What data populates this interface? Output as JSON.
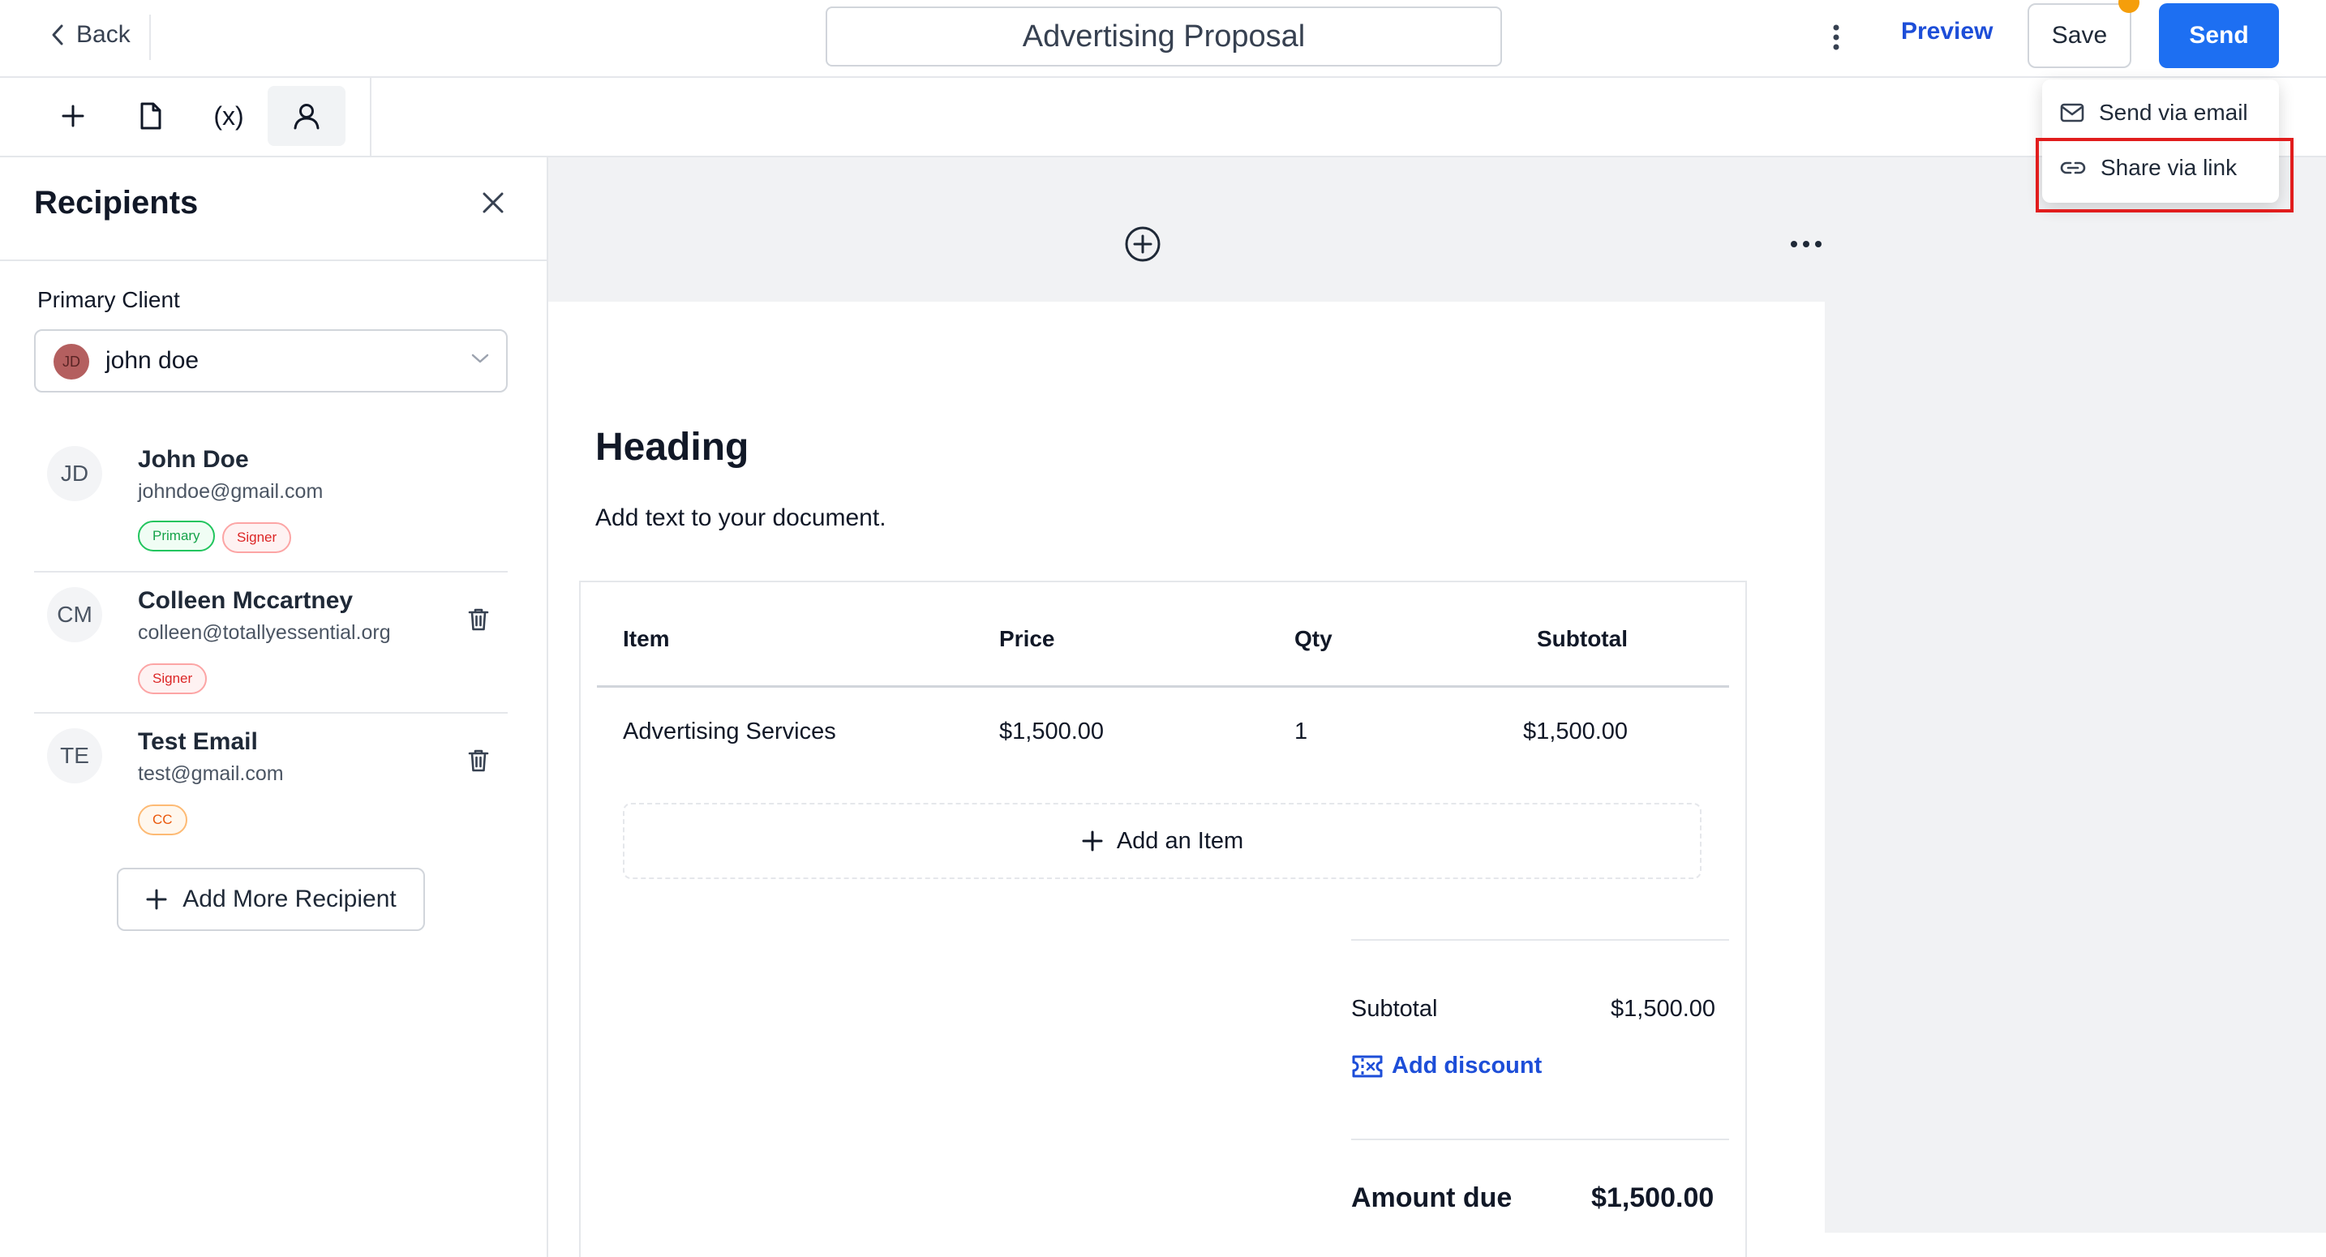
{
  "header": {
    "back_label": "Back",
    "document_title": "Advertising Proposal",
    "preview_label": "Preview",
    "save_label": "Save",
    "send_label": "Send"
  },
  "send_menu": {
    "items": [
      {
        "label": "Send via email",
        "icon": "mail-icon"
      },
      {
        "label": "Share via link",
        "icon": "link-icon"
      }
    ]
  },
  "toolbar": {
    "tools": [
      {
        "name": "add",
        "icon": "plus-icon"
      },
      {
        "name": "document",
        "icon": "file-icon"
      },
      {
        "name": "variables",
        "icon": "variable-icon",
        "text": "(x)"
      },
      {
        "name": "recipients",
        "icon": "user-icon",
        "active": true
      }
    ]
  },
  "sidebar": {
    "title": "Recipients",
    "primary_client_label": "Primary Client",
    "primary_client": {
      "initials": "JD",
      "name": "john doe"
    },
    "recipients": [
      {
        "initials": "JD",
        "name": "John Doe",
        "email": "johndoe@gmail.com",
        "badges": [
          "Primary",
          "Signer"
        ]
      },
      {
        "initials": "CM",
        "name": "Colleen Mccartney",
        "email": "colleen@totallyessential.org",
        "badges": [
          "Signer"
        ]
      },
      {
        "initials": "TE",
        "name": "Test Email",
        "email": "test@gmail.com",
        "badges": [
          "CC"
        ]
      }
    ],
    "add_more_label": "Add More Recipient"
  },
  "document": {
    "heading": "Heading",
    "body_text": "Add text to your document.",
    "table": {
      "columns": [
        "Item",
        "Price",
        "Qty",
        "Subtotal"
      ],
      "rows": [
        [
          "Advertising Services",
          "$1,500.00",
          "1",
          "$1,500.00"
        ]
      ],
      "add_item_label": "Add an Item"
    },
    "summary": {
      "subtotal_label": "Subtotal",
      "subtotal_value": "$1,500.00",
      "add_discount_label": "Add discount",
      "amount_due_label": "Amount due",
      "amount_due_value": "$1,500.00"
    }
  },
  "colors": {
    "primary": "#1d6ff2",
    "link": "#1d4ed8",
    "notification": "#f59e0b",
    "highlight": "#e11d1d"
  }
}
